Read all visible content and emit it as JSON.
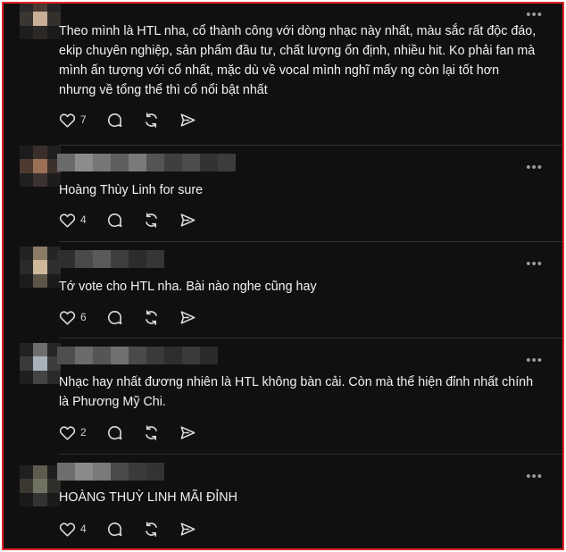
{
  "icons": {
    "more": "more-horizontal-icon",
    "like": "heart-icon",
    "reply": "comment-bubble-icon",
    "repost": "repost-icon",
    "share": "send-icon"
  },
  "ui": {
    "more_glyph": "•••"
  },
  "comments": [
    {
      "text": "Theo mình là HTL nha, cổ thành công với dòng nhạc này nhất, màu sắc rất độc đáo, ekip chuyên nghiệp, sản phẩm đầu tư, chất lượng ổn định, nhiều hit. Ko phải fan mà mình ấn tượng với cổ nhất, mặc dù về vocal mình nghĩ mấy ng còn lại tốt hơn nhưng về tổng thể thì cổ nổi bật nhất",
      "likes": "7"
    },
    {
      "text": "Hoàng Thùy Linh for sure",
      "likes": "4"
    },
    {
      "text": "Tớ vote cho HTL nha. Bài nào nghe cũng hay",
      "likes": "6"
    },
    {
      "text": "Nhạc hay nhất đương nhiên là HTL không bàn cải. Còn mà thể hiện đỉnh nhất chính là Phương Mỹ Chi.",
      "likes": "2"
    },
    {
      "text": "HOÀNG THUỲ LINH MÃI ĐỈNH",
      "likes": "4"
    }
  ]
}
